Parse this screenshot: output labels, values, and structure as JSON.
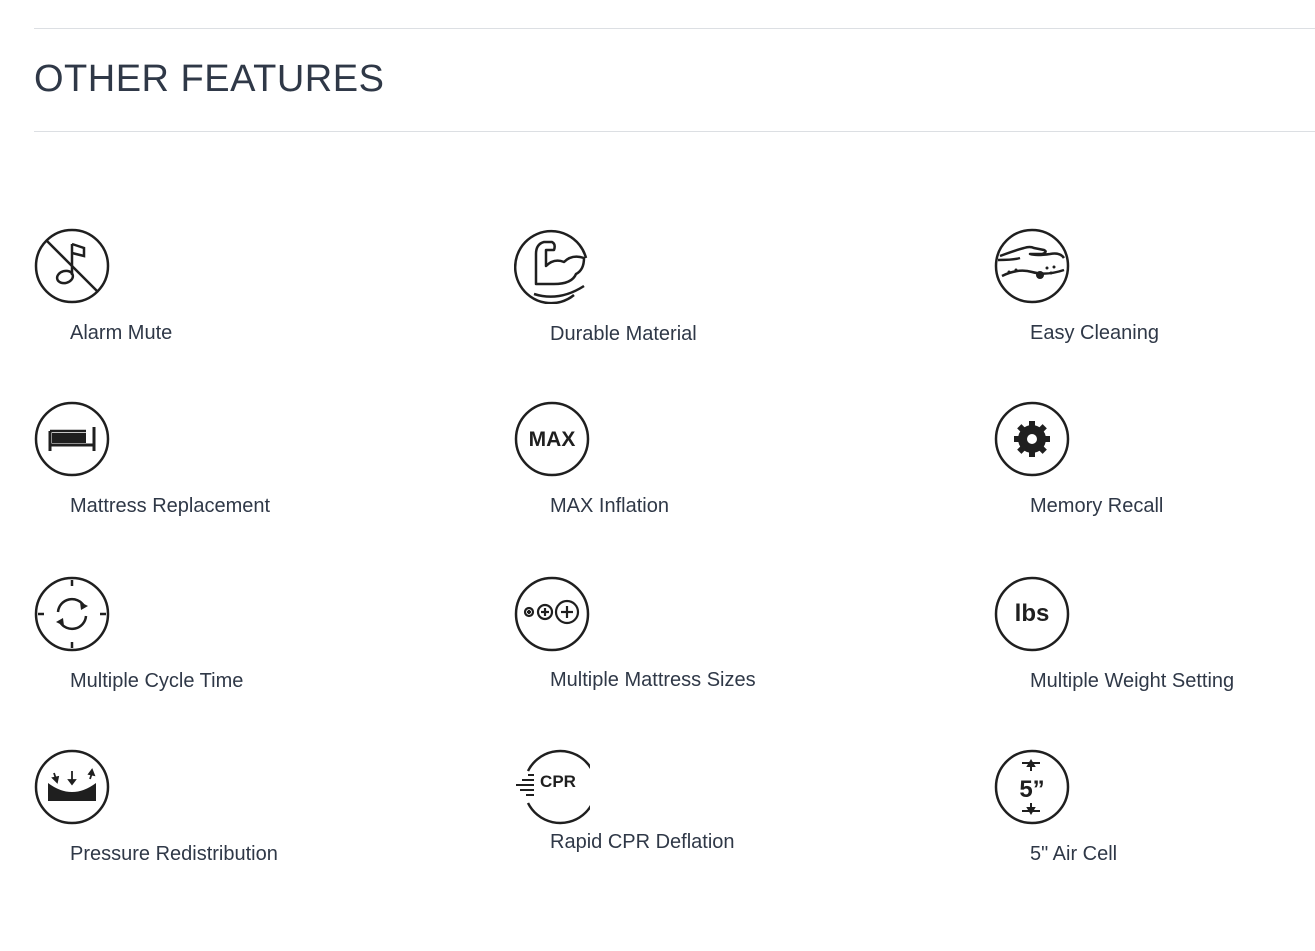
{
  "section": {
    "title": "OTHER FEATURES"
  },
  "features": [
    {
      "label": "Alarm Mute",
      "icon": "alarm-mute-icon"
    },
    {
      "label": "Durable Material",
      "icon": "durable-material-icon"
    },
    {
      "label": "Easy Cleaning",
      "icon": "easy-cleaning-icon"
    },
    {
      "label": "Mattress Replacement",
      "icon": "mattress-replacement-icon"
    },
    {
      "label": "MAX Inflation",
      "icon": "max-inflation-icon",
      "icon_text": "MAX"
    },
    {
      "label": "Memory Recall",
      "icon": "memory-recall-icon"
    },
    {
      "label": "Multiple Cycle Time",
      "icon": "cycle-time-icon"
    },
    {
      "label": "Multiple Mattress Sizes",
      "icon": "mattress-sizes-icon"
    },
    {
      "label": "Multiple Weight Setting",
      "icon": "weight-setting-icon",
      "icon_text": "lbs"
    },
    {
      "label": "Pressure Redistribution",
      "icon": "pressure-redistribution-icon"
    },
    {
      "label": "Rapid CPR Deflation",
      "icon": "cpr-deflation-icon",
      "icon_text": "CPR"
    },
    {
      "label": "5\" Air Cell",
      "icon": "air-cell-icon",
      "icon_text": "5”"
    }
  ],
  "colors": {
    "text": "#2f3847",
    "icon_stroke": "#1f1f1f",
    "rule": "#dcdfe3"
  }
}
